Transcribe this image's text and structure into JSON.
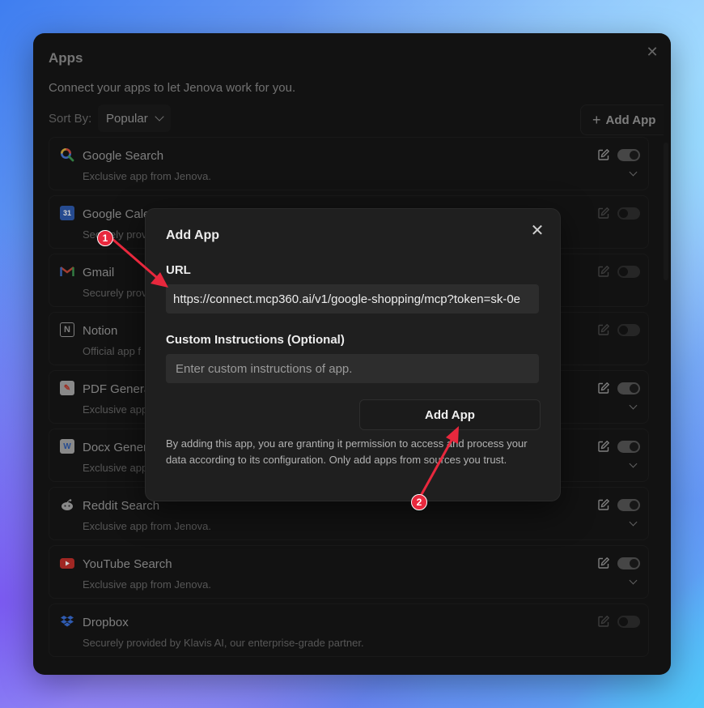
{
  "window": {
    "title": "Apps",
    "subtitle": "Connect your apps to let Jenova work for you.",
    "sort_label": "Sort By:",
    "sort_value": "Popular",
    "add_app_label": "Add App"
  },
  "apps": [
    {
      "name": "Google Search",
      "desc": "Exclusive app from Jenova.",
      "icon": "google-search-icon",
      "enabled": true,
      "expandable": true
    },
    {
      "name": "Google Cale",
      "desc": "Securely provid",
      "icon": "google-calendar-icon",
      "enabled": false,
      "expandable": false
    },
    {
      "name": "Gmail",
      "desc": "Securely prov",
      "icon": "gmail-icon",
      "enabled": false,
      "expandable": false
    },
    {
      "name": "Notion",
      "desc": "Official app f",
      "icon": "notion-icon",
      "enabled": false,
      "expandable": false
    },
    {
      "name": "PDF Genera",
      "desc": "Exclusive app",
      "icon": "pdf-icon",
      "enabled": true,
      "expandable": true
    },
    {
      "name": "Docx Gener",
      "desc": "Exclusive app",
      "icon": "docx-icon",
      "enabled": true,
      "expandable": true
    },
    {
      "name": "Reddit Search",
      "desc": "Exclusive app from Jenova.",
      "icon": "reddit-icon",
      "enabled": true,
      "expandable": true
    },
    {
      "name": "YouTube Search",
      "desc": "Exclusive app from Jenova.",
      "icon": "youtube-icon",
      "enabled": true,
      "expandable": true
    },
    {
      "name": "Dropbox",
      "desc": "Securely provided by Klavis AI, our enterprise-grade partner.",
      "icon": "dropbox-icon",
      "enabled": false,
      "expandable": false
    }
  ],
  "modal": {
    "title": "Add App",
    "url_label": "URL",
    "url_value": "https://connect.mcp360.ai/v1/google-shopping/mcp?token=sk-0e",
    "custom_label": "Custom Instructions (Optional)",
    "custom_placeholder": "Enter custom instructions of app.",
    "add_button": "Add App",
    "disclaimer": "By adding this app, you are granting it permission to access and process your data according to its configuration. Only add apps from sources you trust."
  },
  "annotations": {
    "badge_1": "1",
    "badge_2": "2",
    "accent": "#e8283d"
  }
}
